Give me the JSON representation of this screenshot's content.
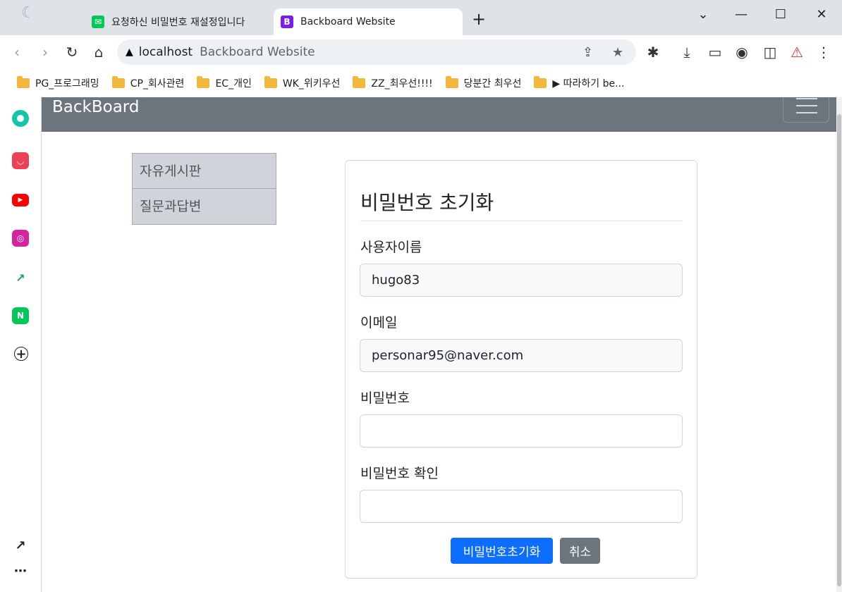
{
  "browser": {
    "tabs": [
      {
        "title": "요청하신 비밀번호 재설정입니다",
        "active": false
      },
      {
        "title": "Backboard Website",
        "active": true
      }
    ],
    "new_tab_label": "+",
    "window_controls": {
      "dropdown": "⌄",
      "minimize": "—",
      "maximize": "☐",
      "close": "✕"
    },
    "address": {
      "host": "localhost",
      "title": "Backboard Website"
    },
    "bookmarks": [
      "PG_프로그래밍",
      "CP_회사관련",
      "EC_개인",
      "WK_위키우선",
      "ZZ_최우선!!!!",
      "당분간 최우선",
      "▶ 따라하기 be..."
    ],
    "side_panel_icons": [
      "naver-whale-icon",
      "pocket-icon",
      "youtube-icon",
      "instagram-icon",
      "stock-chart-icon",
      "naver-mail-icon",
      "add-icon",
      "open-external-icon",
      "more-icon"
    ]
  },
  "navbar": {
    "brand": "BackBoard"
  },
  "sidemenu": {
    "items": [
      "자유게시판",
      "질문과답변"
    ]
  },
  "form": {
    "title": "비밀번호 초기화",
    "username_label": "사용자이름",
    "username_value": "hugo83",
    "email_label": "이메일",
    "email_value": "personar95@naver.com",
    "password_label": "비밀번호",
    "password_value": "",
    "confirm_label": "비밀번호 확인",
    "confirm_value": "",
    "submit_label": "비밀번호초기화",
    "cancel_label": "취소"
  },
  "colors": {
    "navbar": "#6c757d",
    "primary": "#0d6efd",
    "secondary": "#6c757d",
    "menu_bg": "#d0d4da"
  }
}
